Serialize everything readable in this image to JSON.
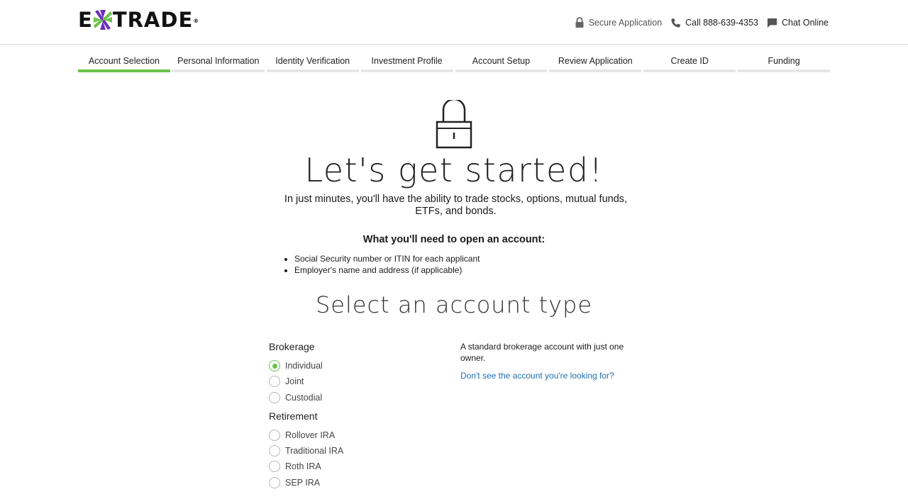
{
  "header": {
    "logo": {
      "left": "E",
      "right": "TRADE",
      "mark": "®",
      "accent": "#6b2dbd",
      "accent2": "#6cc24a"
    },
    "secure_label": "Secure Application",
    "call_label": "Call 888-639-4353",
    "chat_label": "Chat Online"
  },
  "steps": [
    {
      "label": "Account Selection",
      "active": true
    },
    {
      "label": "Personal Information",
      "active": false
    },
    {
      "label": "Identity Verification",
      "active": false
    },
    {
      "label": "Investment Profile",
      "active": false
    },
    {
      "label": "Account Setup",
      "active": false
    },
    {
      "label": "Review Application",
      "active": false
    },
    {
      "label": "Create ID",
      "active": false
    },
    {
      "label": "Funding",
      "active": false
    }
  ],
  "main": {
    "title": "Let's get started!",
    "intro": "In just minutes, you'll have the ability to trade stocks, options, mutual funds, ETFs, and bonds.",
    "need_title": "What you'll need to open an account:",
    "need_items": [
      "Social Security number or ITIN for each applicant",
      "Employer's name and address (if applicable)"
    ],
    "subtitle": "Select an account type"
  },
  "account_types": {
    "brokerage_title": "Brokerage",
    "brokerage_options": [
      {
        "label": "Individual",
        "checked": true
      },
      {
        "label": "Joint",
        "checked": false
      },
      {
        "label": "Custodial",
        "checked": false
      }
    ],
    "retirement_title": "Retirement",
    "retirement_options": [
      {
        "label": "Rollover IRA",
        "checked": false
      },
      {
        "label": "Traditional IRA",
        "checked": false
      },
      {
        "label": "Roth IRA",
        "checked": false
      },
      {
        "label": "SEP IRA",
        "checked": false
      }
    ],
    "description": "A standard brokerage account with just one owner.",
    "help_link": "Don't see the account you're looking for?"
  },
  "colors": {
    "progress_active": "#6cc24a",
    "link": "#1f6fb2"
  }
}
